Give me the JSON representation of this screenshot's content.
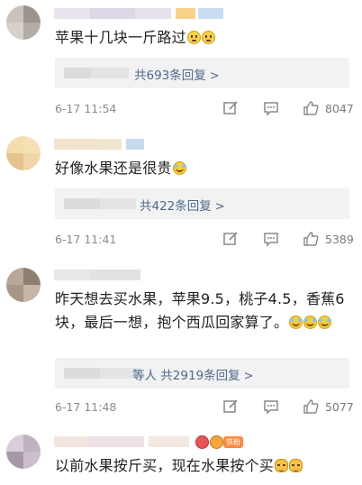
{
  "comments": [
    {
      "text": "苹果十几块一斤路过",
      "emoji_names": [
        "thinking-face-icon",
        "thinking-face-icon"
      ],
      "reply_link": "共693条回复",
      "time": "6-17 11:54",
      "likes": "8047"
    },
    {
      "text": "好像水果还是很贵",
      "emoji_names": [
        "laughing-tears-icon"
      ],
      "reply_link": "共422条回复",
      "time": "6-17 11:41",
      "likes": "5389"
    },
    {
      "text": "昨天想去买水果，苹果9.5，桃子4.5，香蕉6块，最后一想，抱个西瓜回家算了。",
      "emoji_names": [
        "laughing-tears-icon",
        "laughing-tears-icon",
        "laughing-tears-icon"
      ],
      "reply_prefix": "等人",
      "reply_link": "共2919条回复",
      "time": "6-17 11:48",
      "likes": "5077"
    },
    {
      "text": "以前水果按斤买，现在水果按个买",
      "emoji_names": [
        "cat-face-icon",
        "cat-face-icon"
      ],
      "badge": "铁粉"
    }
  ],
  "icons": {
    "edit": "edit-icon",
    "comment": "comment-icon",
    "like": "thumbs-up-icon",
    "chevron": "chevron-right-icon"
  },
  "colors": {
    "link": "#4e6a8c",
    "meta": "#8c8c8c",
    "reply_bg": "#f2f2f2",
    "badge": "#ff8a3d"
  }
}
